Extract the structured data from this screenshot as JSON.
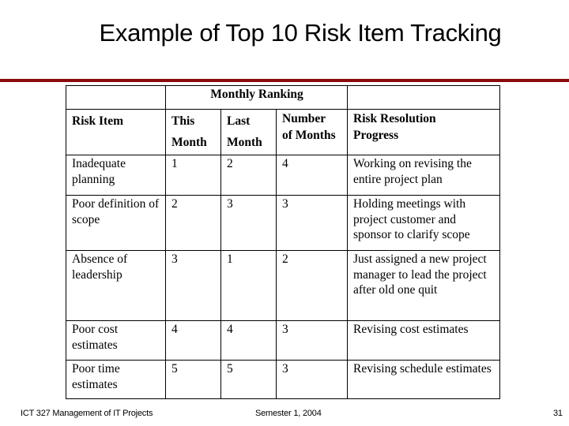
{
  "slide": {
    "title": "Example of Top 10 Risk Item Tracking",
    "accent_color": "#8b0a0a"
  },
  "table": {
    "group_header": "Monthly Ranking",
    "headers": {
      "risk_item": "Risk Item",
      "this_month": [
        "This",
        "Month"
      ],
      "last_month": [
        "Last",
        "Month"
      ],
      "number_of_months": [
        "Number",
        "of Months"
      ],
      "progress": [
        "Risk Resolution",
        "Progress"
      ]
    },
    "rows": [
      {
        "risk_item": "Inadequate planning",
        "this_month": "1",
        "last_month": "2",
        "number_of_months": "4",
        "progress": "Working on revising the entire project plan"
      },
      {
        "risk_item": "Poor definition of scope",
        "this_month": "2",
        "last_month": "3",
        "number_of_months": "3",
        "progress": "Holding meetings with project customer and sponsor to clarify scope"
      },
      {
        "risk_item": "Absence of leadership",
        "this_month": "3",
        "last_month": "1",
        "number_of_months": "2",
        "progress": "Just assigned a new project manager to lead the project after old one quit"
      },
      {
        "risk_item": "Poor cost estimates",
        "this_month": "4",
        "last_month": "4",
        "number_of_months": "3",
        "progress": "Revising cost estimates"
      },
      {
        "risk_item": "Poor time estimates",
        "this_month": "5",
        "last_month": "5",
        "number_of_months": "3",
        "progress": "Revising schedule estimates"
      }
    ]
  },
  "footer": {
    "course": "ICT 327 Management of IT Projects",
    "semester": "Semester 1, 2004",
    "page_number": "31"
  }
}
